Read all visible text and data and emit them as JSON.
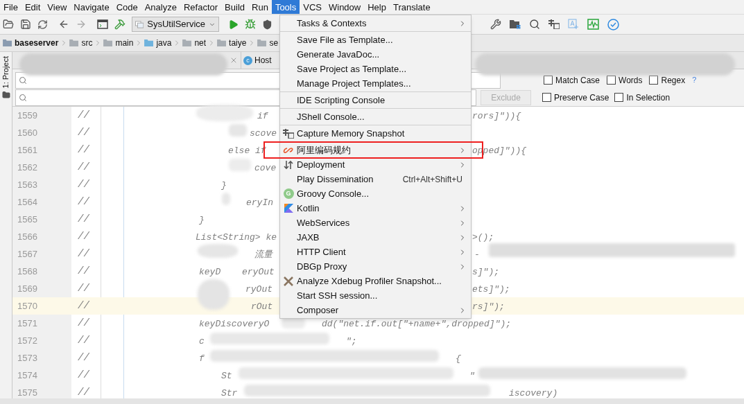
{
  "menubar": [
    {
      "label": "File",
      "selected": false
    },
    {
      "label": "Edit",
      "selected": false
    },
    {
      "label": "View",
      "selected": false
    },
    {
      "label": "Navigate",
      "selected": false
    },
    {
      "label": "Code",
      "selected": false
    },
    {
      "label": "Analyze",
      "selected": false
    },
    {
      "label": "Refactor",
      "selected": false
    },
    {
      "label": "Build",
      "selected": false
    },
    {
      "label": "Run",
      "selected": false
    },
    {
      "label": "Tools",
      "selected": true
    },
    {
      "label": "VCS",
      "selected": false
    },
    {
      "label": "Window",
      "selected": false
    },
    {
      "label": "Help",
      "selected": false
    },
    {
      "label": "Translate",
      "selected": false
    }
  ],
  "toolbar": {
    "run_config": "SysUtilService"
  },
  "breadcrumbs": [
    {
      "label": "baseserver",
      "kind": "module"
    },
    {
      "label": "src",
      "kind": "folder"
    },
    {
      "label": "main",
      "kind": "folder"
    },
    {
      "label": "java",
      "kind": "source"
    },
    {
      "label": "net",
      "kind": "package"
    },
    {
      "label": "taiye",
      "kind": "package"
    },
    {
      "label": "se",
      "kind": "package"
    }
  ],
  "side_panel": {
    "label": "1: Project"
  },
  "tabs": [
    {
      "label": "Host",
      "icon_label": "c",
      "selected": false
    }
  ],
  "find": {
    "exclude_button": {
      "label": "Exclude",
      "disabled": true
    },
    "options_row_1": [
      {
        "label": "Match Case",
        "checked": false
      },
      {
        "label": "Words",
        "checked": false
      },
      {
        "label": "Regex",
        "checked": false
      }
    ],
    "help": "?",
    "options_row_2": [
      {
        "label": "Preserve Case",
        "checked": false
      },
      {
        "label": "In Selection",
        "checked": false
      }
    ]
  },
  "code_lines": [
    {
      "number": "1559",
      "comment": "//",
      "parts": [
        "if",
        "rors]\")){"
      ],
      "current": false
    },
    {
      "number": "1560",
      "comment": "//",
      "parts": [
        "scove"
      ],
      "current": false
    },
    {
      "number": "1561",
      "comment": "//",
      "parts": [
        "else if",
        "opped]\")){"
      ],
      "current": false
    },
    {
      "number": "1562",
      "comment": "//",
      "parts": [
        "cove"
      ],
      "current": false
    },
    {
      "number": "1563",
      "comment": "//",
      "parts": [
        "}"
      ],
      "current": false
    },
    {
      "number": "1564",
      "comment": "//",
      "parts": [
        "eryIn"
      ],
      "current": false
    },
    {
      "number": "1565",
      "comment": "//",
      "parts": [
        "}"
      ],
      "current": false
    },
    {
      "number": "1566",
      "comment": "//",
      "parts": [
        "List<String> ke",
        ">();"
      ],
      "current": false
    },
    {
      "number": "1567",
      "comment": "//",
      "parts": [
        "流量",
        "-"
      ],
      "current": false
    },
    {
      "number": "1568",
      "comment": "//",
      "parts": [
        "keyD",
        "eryOut",
        "s]\");"
      ],
      "current": false
    },
    {
      "number": "1569",
      "comment": "//",
      "parts": [
        "ryOut",
        "ets]\");"
      ],
      "current": false
    },
    {
      "number": "1570",
      "comment": "//",
      "parts": [
        "rOut",
        "rs]\");"
      ],
      "current": true
    },
    {
      "number": "1571",
      "comment": "//",
      "parts": [
        "keyDiscoveryO",
        "dd(\"net.if.out[\"+name+\",dropped]\");"
      ],
      "current": false
    },
    {
      "number": "1572",
      "comment": "//",
      "parts": [
        "c",
        "\";"
      ],
      "current": false
    },
    {
      "number": "1573",
      "comment": "//",
      "parts": [
        "f",
        "{"
      ],
      "current": false
    },
    {
      "number": "1574",
      "comment": "//",
      "parts": [
        "St",
        "\""
      ],
      "current": false
    },
    {
      "number": "1575",
      "comment": "//",
      "parts": [
        "Str",
        "iscovery)"
      ],
      "current": false
    }
  ],
  "tools_menu": [
    {
      "label": "Tasks & Contexts",
      "kind": "plain",
      "submenu": true,
      "separator_before": false,
      "annotated": false
    },
    {
      "label": "Save File as Template...",
      "kind": "plain",
      "submenu": false,
      "separator_before": true,
      "annotated": false
    },
    {
      "label": "Generate JavaDoc...",
      "kind": "plain",
      "submenu": false,
      "separator_before": false,
      "annotated": false
    },
    {
      "label": "Save Project as Template...",
      "kind": "plain",
      "submenu": false,
      "separator_before": false,
      "annotated": false
    },
    {
      "label": "Manage Project Templates...",
      "kind": "plain",
      "submenu": false,
      "separator_before": false,
      "annotated": false
    },
    {
      "label": "IDE Scripting Console",
      "kind": "plain",
      "submenu": false,
      "separator_before": true,
      "annotated": false
    },
    {
      "label": "JShell Console...",
      "kind": "plain",
      "submenu": false,
      "separator_before": true,
      "annotated": false
    },
    {
      "label": "Capture Memory Snapshot",
      "kind": "memory",
      "submenu": false,
      "separator_before": true,
      "annotated": false
    },
    {
      "label": "阿里编码规约",
      "kind": "alibaba",
      "submenu": true,
      "separator_before": true,
      "annotated": true
    },
    {
      "label": "Deployment",
      "kind": "deploy",
      "submenu": true,
      "separator_before": false,
      "annotated": false
    },
    {
      "label": "Play Dissemination",
      "kind": "plain",
      "shortcut": "Ctrl+Alt+Shift+U",
      "submenu": false,
      "separator_before": false,
      "annotated": false
    },
    {
      "label": "Groovy Console...",
      "kind": "groovy",
      "icon_label": "G",
      "submenu": false,
      "separator_before": false,
      "annotated": false
    },
    {
      "label": "Kotlin",
      "kind": "kotlin",
      "submenu": true,
      "separator_before": false,
      "annotated": false
    },
    {
      "label": "WebServices",
      "kind": "plain",
      "submenu": true,
      "separator_before": false,
      "annotated": false
    },
    {
      "label": "JAXB",
      "kind": "plain",
      "submenu": true,
      "separator_before": false,
      "annotated": false
    },
    {
      "label": "HTTP Client",
      "kind": "plain",
      "submenu": true,
      "separator_before": false,
      "annotated": false
    },
    {
      "label": "DBGp Proxy",
      "kind": "plain",
      "submenu": true,
      "separator_before": false,
      "annotated": false
    },
    {
      "label": "Analyze Xdebug Profiler Snapshot...",
      "kind": "xdebug",
      "submenu": false,
      "separator_before": false,
      "annotated": false
    },
    {
      "label": "Start SSH session...",
      "kind": "plain",
      "submenu": false,
      "separator_before": false,
      "annotated": false
    },
    {
      "label": "Composer",
      "kind": "plain",
      "submenu": true,
      "separator_before": false,
      "annotated": false
    }
  ]
}
